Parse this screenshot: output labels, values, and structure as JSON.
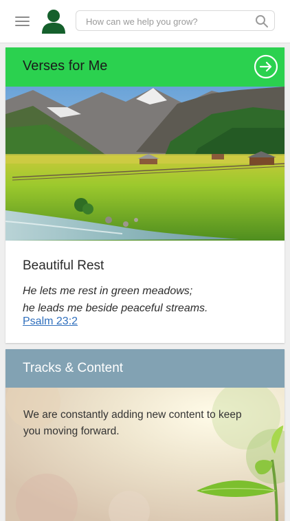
{
  "header": {
    "menu_icon": "hamburger-menu-icon",
    "avatar_icon": "user-avatar-icon",
    "search": {
      "placeholder": "How can we help you grow?",
      "value": "",
      "icon": "search-icon"
    }
  },
  "verses_card": {
    "title": "Verses for Me",
    "header_color": "#2bd14f",
    "arrow_icon": "arrow-right-circle-icon",
    "image_subject": "mountain-meadow-stream",
    "verse_title": "Beautiful Rest",
    "verse_line1": "He lets me rest in green meadows;",
    "verse_line2": "he leads me beside peaceful streams.",
    "reference": "Psalm 23:2"
  },
  "tracks_card": {
    "title": "Tracks & Content",
    "header_color": "#82a2b3",
    "description": "We are constantly adding new content to keep you moving forward."
  },
  "colors": {
    "avatar": "#15602c",
    "link": "#2f6fbd"
  }
}
